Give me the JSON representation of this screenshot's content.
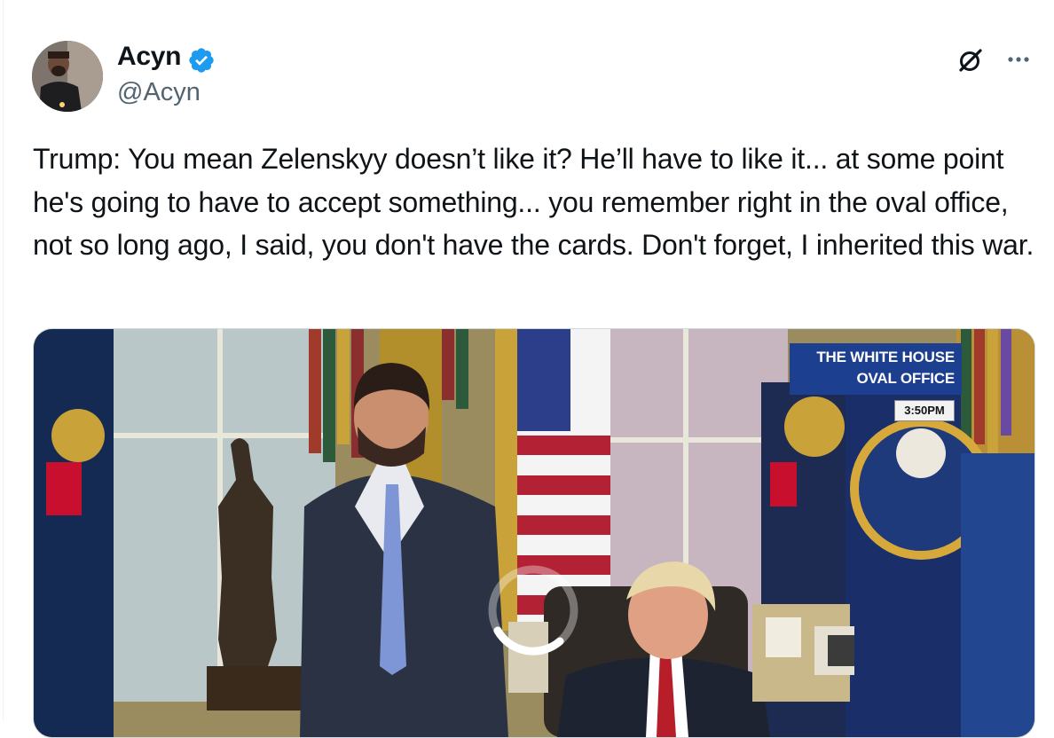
{
  "author": {
    "display_name": "Acyn",
    "handle": "@Acyn",
    "verified_color": "#1d9bf0"
  },
  "actions": {
    "grok_icon": "grok-icon",
    "more_icon": "more-options-icon"
  },
  "tweet": {
    "text": "Trump: You mean Zelenskyy doesn’t like it? He’ll have to like it... at some point he's going to have to accept something... you remember right in the oval office, not so long ago, I said, you don't have the cards. Don't forget, I inherited this war."
  },
  "media": {
    "chyron_line1": "THE WHITE HOUSE",
    "chyron_line2": "OVAL OFFICE",
    "chyron_time": "3:50PM",
    "loading": true
  },
  "colors": {
    "text": "#0f1419",
    "secondary": "#536471",
    "border": "#cfd9de"
  }
}
